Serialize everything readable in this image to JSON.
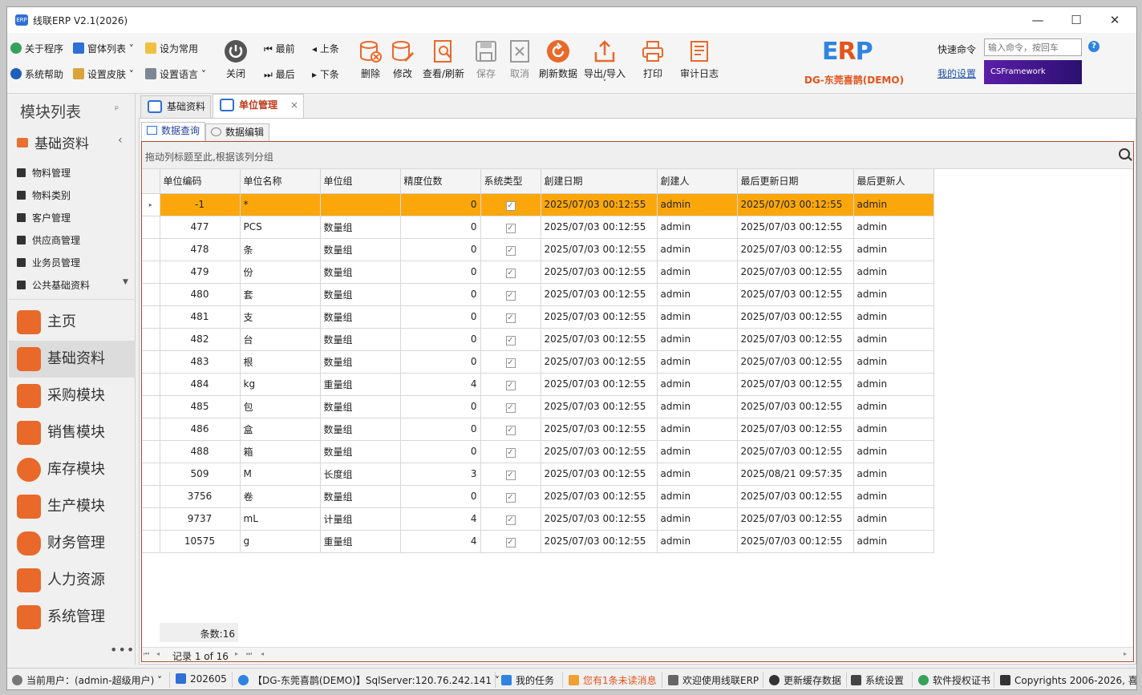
{
  "window": {
    "title": "线联ERP V2.1(2026)"
  },
  "ribbon": {
    "small_left": [
      "关于程序",
      "窗体列表",
      "设为常用",
      "系统帮助",
      "设置皮肤",
      "设置语言"
    ],
    "close_label": "关闭",
    "nav": {
      "first": "最前",
      "prev": "上条",
      "last": "最后",
      "next": "下条"
    },
    "buttons": [
      "删除",
      "修改",
      "查看/刷新",
      "保存",
      "取消",
      "刷新数据",
      "导出/导入",
      "打印",
      "审计日志"
    ],
    "brand": "DG-东莞喜鹊(DEMO)",
    "quick_label": "快速命令",
    "quick_placeholder": "输入命令，按回车",
    "my_settings": "我的设置",
    "banner": "CSFramework"
  },
  "sidebar": {
    "title": "模块列表",
    "group": "基础资料",
    "items": [
      "物料管理",
      "物料类别",
      "客户管理",
      "供应商管理",
      "业务员管理",
      "公共基础资料"
    ],
    "modules": [
      "主页",
      "基础资料",
      "采购模块",
      "销售模块",
      "库存模块",
      "生产模块",
      "财务管理",
      "人力资源",
      "系统管理"
    ],
    "more": "•••"
  },
  "tabs": [
    "基础资料",
    "单位管理"
  ],
  "subtabs": [
    "数据查询",
    "数据编辑"
  ],
  "grid": {
    "group_hint": "拖动列标题至此,根据该列分组",
    "columns": [
      "单位编码",
      "单位名称",
      "单位组",
      "精度位数",
      "系统类型",
      "創建日期",
      "創建人",
      "最后更新日期",
      "最后更新人"
    ],
    "rows": [
      [
        "-1",
        "*",
        "",
        "0",
        "✓",
        "2025/07/03 00:12:55",
        "admin",
        "2025/07/03 00:12:55",
        "admin"
      ],
      [
        "477",
        "PCS",
        "数量组",
        "0",
        "✓",
        "2025/07/03 00:12:55",
        "admin",
        "2025/07/03 00:12:55",
        "admin"
      ],
      [
        "478",
        "条",
        "数量组",
        "0",
        "✓",
        "2025/07/03 00:12:55",
        "admin",
        "2025/07/03 00:12:55",
        "admin"
      ],
      [
        "479",
        "份",
        "数量组",
        "0",
        "✓",
        "2025/07/03 00:12:55",
        "admin",
        "2025/07/03 00:12:55",
        "admin"
      ],
      [
        "480",
        "套",
        "数量组",
        "0",
        "✓",
        "2025/07/03 00:12:55",
        "admin",
        "2025/07/03 00:12:55",
        "admin"
      ],
      [
        "481",
        "支",
        "数量组",
        "0",
        "✓",
        "2025/07/03 00:12:55",
        "admin",
        "2025/07/03 00:12:55",
        "admin"
      ],
      [
        "482",
        "台",
        "数量组",
        "0",
        "✓",
        "2025/07/03 00:12:55",
        "admin",
        "2025/07/03 00:12:55",
        "admin"
      ],
      [
        "483",
        "根",
        "数量组",
        "0",
        "✓",
        "2025/07/03 00:12:55",
        "admin",
        "2025/07/03 00:12:55",
        "admin"
      ],
      [
        "484",
        "kg",
        "重量组",
        "4",
        "✓",
        "2025/07/03 00:12:55",
        "admin",
        "2025/07/03 00:12:55",
        "admin"
      ],
      [
        "485",
        "包",
        "数量组",
        "0",
        "✓",
        "2025/07/03 00:12:55",
        "admin",
        "2025/07/03 00:12:55",
        "admin"
      ],
      [
        "486",
        "盒",
        "数量组",
        "0",
        "✓",
        "2025/07/03 00:12:55",
        "admin",
        "2025/07/03 00:12:55",
        "admin"
      ],
      [
        "488",
        "箱",
        "数量组",
        "0",
        "✓",
        "2025/07/03 00:12:55",
        "admin",
        "2025/07/03 00:12:55",
        "admin"
      ],
      [
        "509",
        "M",
        "长度组",
        "3",
        "✓",
        "2025/07/03 00:12:55",
        "admin",
        "2025/08/21 09:57:35",
        "admin"
      ],
      [
        "3756",
        "卷",
        "数量组",
        "0",
        "✓",
        "2025/07/03 00:12:55",
        "admin",
        "2025/07/03 00:12:55",
        "admin"
      ],
      [
        "9737",
        "mL",
        "计量组",
        "4",
        "✓",
        "2025/07/03 00:12:55",
        "admin",
        "2025/07/03 00:12:55",
        "admin"
      ],
      [
        "10575",
        "g",
        "重量组",
        "4",
        "✓",
        "2025/07/03 00:12:55",
        "admin",
        "2025/07/03 00:12:55",
        "admin"
      ]
    ],
    "count_label": "条数:16",
    "record_label": "记录 1 of 16"
  },
  "status": {
    "user": "当前用户：(admin-超级用户)",
    "period": "202605",
    "db": "【DG-东莞喜鹊(DEMO)】SqlServer:120.76.242.141",
    "tasks": "我的任务",
    "unread": "您有1条未读消息",
    "welcome": "欢迎使用线联ERP",
    "refresh": "更新缓存数据",
    "settings": "系统设置",
    "license": "软件授权证书",
    "copyright": "Copyrights 2006-2026, 喜"
  },
  "colors": {
    "accent": "#fba70c",
    "brand": "#e2541b",
    "link": "#1f4fa6"
  }
}
